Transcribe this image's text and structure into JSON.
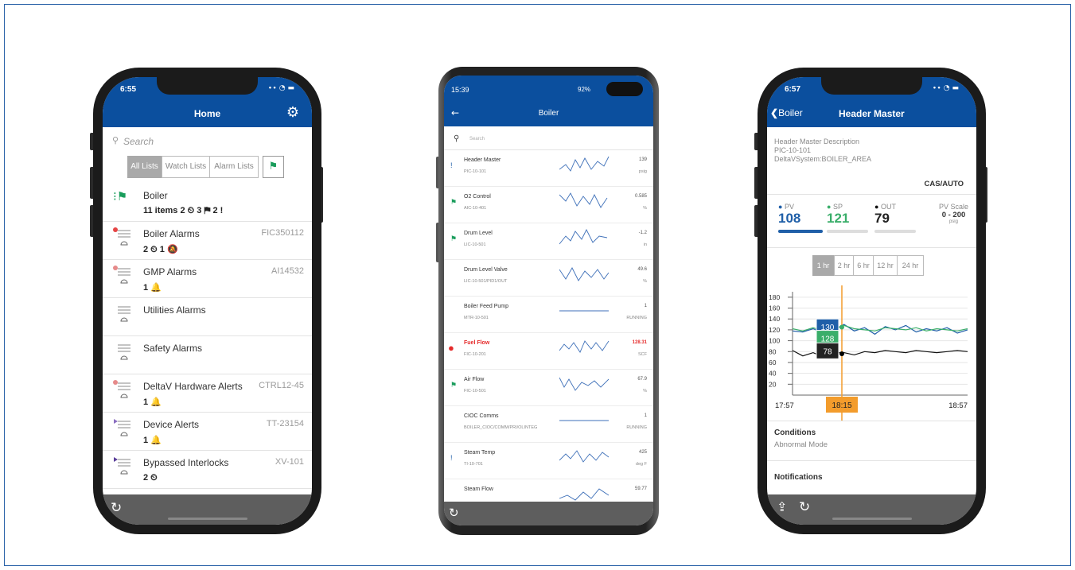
{
  "phone1": {
    "time": "6:55",
    "title": "Home",
    "search_placeholder": "Search",
    "tabs": [
      "All Lists",
      "Watch Lists",
      "Alarm Lists"
    ],
    "rows": [
      {
        "name": "Boiler",
        "tag": "",
        "counts": "11 items 2 ⏲ 3 ⚑ 2 !"
      },
      {
        "name": "Boiler Alarms",
        "tag": "FIC350112",
        "counts": "2 ⏲ 1 🔕"
      },
      {
        "name": "GMP Alarms",
        "tag": "AI14532",
        "counts": "1 🔔"
      },
      {
        "name": "Utilities Alarms",
        "tag": "",
        "counts": ""
      },
      {
        "name": "Safety Alarms",
        "tag": "",
        "counts": ""
      },
      {
        "name": "DeltaV Hardware Alerts",
        "tag": "CTRL12-45",
        "counts": "1 🔔"
      },
      {
        "name": "Device Alerts",
        "tag": "TT-23154",
        "counts": "1 🔔"
      },
      {
        "name": "Bypassed Interlocks",
        "tag": "XV-101",
        "counts": "2 ⏲"
      }
    ]
  },
  "phone2": {
    "status_time": "15:39",
    "status_right": "92%",
    "title": "Boiler",
    "search_placeholder": "Search",
    "rows": [
      {
        "name": "Header Master",
        "sub": "PIC-10-101",
        "value": "139",
        "unit": "psig",
        "marker": "!"
      },
      {
        "name": "O2 Control",
        "sub": "AIC-10-401",
        "value": "0.585",
        "unit": "%",
        "marker": "⚑"
      },
      {
        "name": "Drum Level",
        "sub": "LIC-10-501",
        "value": "-1.2",
        "unit": "in",
        "marker": "⚑"
      },
      {
        "name": "Drum Level Valve",
        "sub": "LIC-10-501/PID1/OUT",
        "value": "49.6",
        "unit": "%",
        "marker": ""
      },
      {
        "name": "Boiler Feed Pump",
        "sub": "MTR-10-501",
        "value": "1",
        "unit": "RUNNING",
        "marker": ""
      },
      {
        "name": "Fuel Flow",
        "sub": "FIC-10-201",
        "value": "128.31",
        "unit": "SCF",
        "marker": "●"
      },
      {
        "name": "Air Flow",
        "sub": "FIC-10-501",
        "value": "67.9",
        "unit": "%",
        "marker": "⚑"
      },
      {
        "name": "CIOC Comms",
        "sub": "BOILER_CIOC/COMM/PRI/OLINTEG",
        "value": "1",
        "unit": "RUNNING",
        "marker": ""
      },
      {
        "name": "Steam Temp",
        "sub": "TI-10-701",
        "value": "425",
        "unit": "deg F",
        "marker": "!"
      },
      {
        "name": "Steam Flow",
        "sub": "",
        "value": "59.77",
        "unit": "",
        "marker": ""
      }
    ]
  },
  "phone3": {
    "time": "6:57",
    "back_label": "Boiler",
    "title": "Header Master",
    "description": "Header Master Description",
    "tag": "PIC-10-101",
    "area": "DeltaVSystem:BOILER_AREA",
    "mode": "CAS/AUTO",
    "pv_label": "PV",
    "pv_value": "108",
    "sp_label": "SP",
    "sp_value": "121",
    "out_label": "OUT",
    "out_value": "79",
    "scale_label": "PV Scale",
    "scale_value": "0 - 200",
    "scale_unit": "psig",
    "ranges": [
      "1 hr",
      "2 hr",
      "6 hr",
      "12 hr",
      "24 hr"
    ],
    "conditions_title": "Conditions",
    "conditions_value": "Abnormal Mode",
    "notifications_title": "Notifications",
    "colors": {
      "pv": "#1f5fa8",
      "sp": "#3aae6a",
      "out": "#111111",
      "cursor": "#f39c2c"
    }
  },
  "chart_data": {
    "type": "line",
    "ylim": [
      0,
      190
    ],
    "yticks": [
      20,
      40,
      60,
      80,
      100,
      120,
      140,
      160,
      180
    ],
    "xticks": [
      "17:57",
      "18:57"
    ],
    "cursor_label": "18:15",
    "series": [
      {
        "name": "PV",
        "values": [
          118,
          116,
          122,
          114,
          120,
          130,
          118,
          124,
          112,
          126,
          120,
          128,
          116,
          122,
          118,
          124,
          114,
          120
        ]
      },
      {
        "name": "SP",
        "values": [
          122,
          118,
          124,
          118,
          120,
          128,
          122,
          120,
          118,
          124,
          122,
          120,
          124,
          118,
          122,
          120,
          118,
          122
        ]
      },
      {
        "name": "OUT",
        "values": [
          82,
          72,
          78,
          70,
          78,
          78,
          74,
          80,
          78,
          82,
          80,
          78,
          82,
          80,
          78,
          80,
          82,
          80
        ]
      }
    ],
    "callouts": {
      "pv": "130",
      "sp": "128",
      "out": "78"
    }
  }
}
